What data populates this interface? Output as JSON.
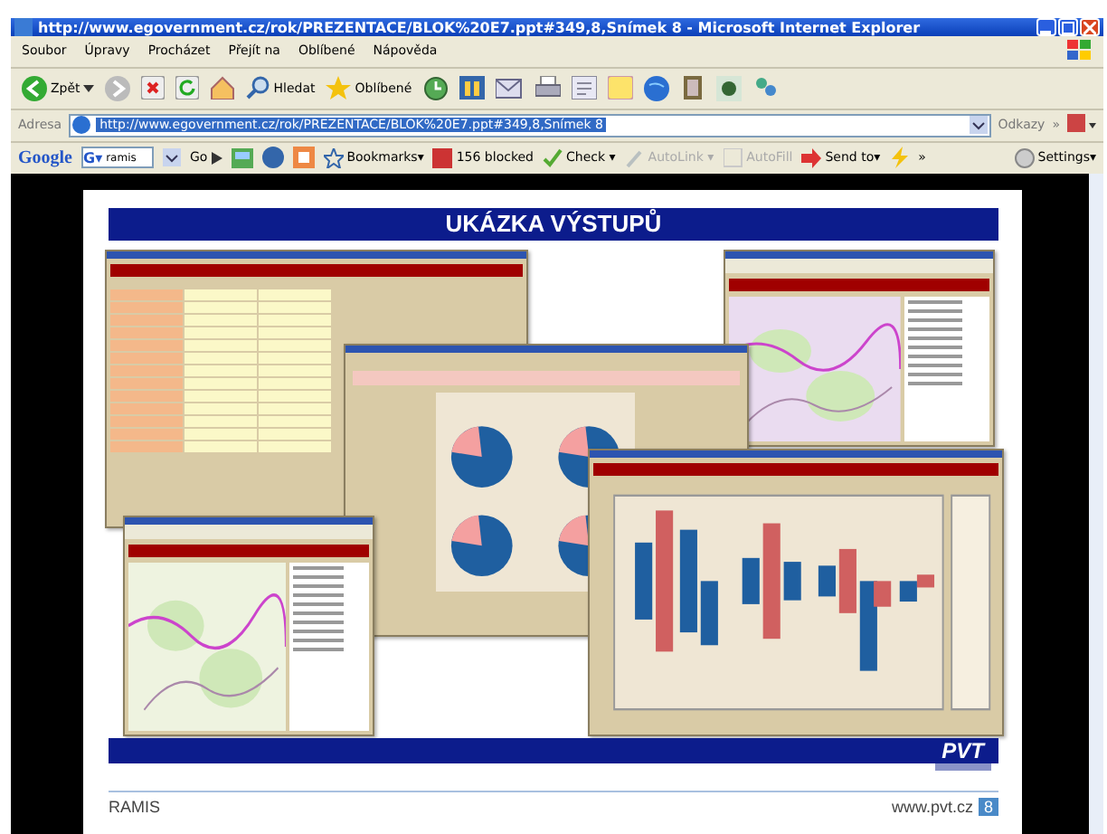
{
  "window": {
    "title": "http://www.egovernment.cz/rok/PREZENTACE/BLOK%20E7.ppt#349,8,Snímek 8 - Microsoft Internet Explorer"
  },
  "menu": [
    "Soubor",
    "Úpravy",
    "Procházet",
    "Přejít na",
    "Oblíbené",
    "Nápověda"
  ],
  "toolbar": {
    "back": "Zpět",
    "search": "Hledat",
    "favorites": "Oblíbené"
  },
  "address": {
    "label": "Adresa",
    "value": "http://www.egovernment.cz/rok/PREZENTACE/BLOK%20E7.ppt#349,8,Snímek 8",
    "links": "Odkazy",
    "more": "»"
  },
  "google_bar": {
    "logo": "Google",
    "engine": "G▾",
    "query": "ramis",
    "go": "Go",
    "items": [
      {
        "kind": "bookmark",
        "label": "Bookmarks▾",
        "disabled": false
      },
      {
        "kind": "blocked",
        "label": "156 blocked",
        "disabled": false
      },
      {
        "kind": "check",
        "label": "Check ▾",
        "disabled": false
      },
      {
        "kind": "autolink",
        "label": "AutoLink ▾",
        "disabled": true
      },
      {
        "kind": "autofill",
        "label": "AutoFill",
        "disabled": true
      },
      {
        "kind": "send",
        "label": "Send to▾",
        "disabled": false
      }
    ],
    "more": "»",
    "settings": "Settings▾"
  },
  "slide": {
    "title": "UKÁZKA VÝSTUPŮ",
    "screens": [
      {
        "kind": "table"
      },
      {
        "kind": "map"
      },
      {
        "kind": "pie"
      },
      {
        "kind": "map"
      },
      {
        "kind": "bar"
      }
    ],
    "logo": "PVT",
    "footer_left": "RAMIS",
    "footer_right": "www.pvt.cz",
    "page": "8"
  }
}
